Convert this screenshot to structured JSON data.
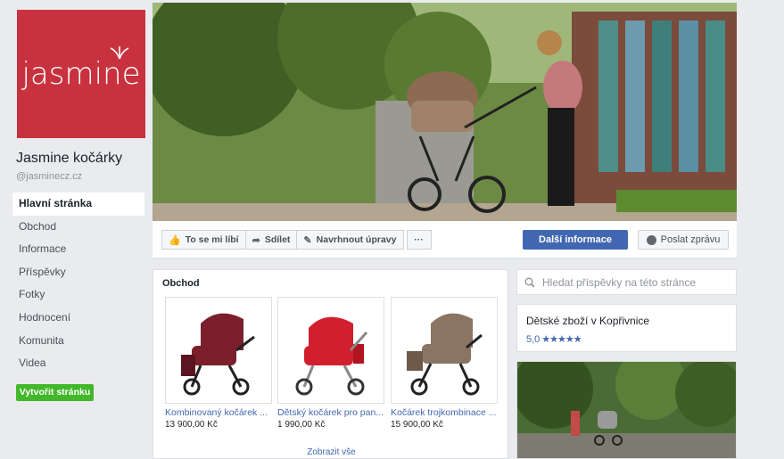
{
  "brand": {
    "logo_text": "jasmine",
    "logo_color": "#c8323e"
  },
  "page": {
    "name": "Jasmine kočárky",
    "handle": "@jasminecz.cz"
  },
  "nav": {
    "items": [
      {
        "label": "Hlavní stránka",
        "active": true
      },
      {
        "label": "Obchod"
      },
      {
        "label": "Informace"
      },
      {
        "label": "Příspěvky"
      },
      {
        "label": "Fotky"
      },
      {
        "label": "Hodnocení"
      },
      {
        "label": "Komunita"
      },
      {
        "label": "Videa"
      }
    ],
    "create_label": "Vytvořit stránku"
  },
  "actions": {
    "like_label": "To se mi líbí",
    "share_label": "Sdílet",
    "suggest_label": "Navrhnout úpravy",
    "more_label": "···",
    "info_label": "Další informace",
    "message_label": "Poslat zprávu"
  },
  "shop": {
    "title": "Obchod",
    "products": [
      {
        "name": "Kombinovaný kočárek ...",
        "price": "13 900,00 Kč",
        "color": "#7a1f2b"
      },
      {
        "name": "Dětský kočárek pro pan...",
        "price": "1 990,00 Kč",
        "color": "#d11f2f"
      },
      {
        "name": "Kočárek trojkombinace ...",
        "price": "15 900,00 Kč",
        "color": "#8b7462"
      }
    ],
    "show_all": "Zobrazit vše"
  },
  "sidebar_right": {
    "search_placeholder": "Hledat příspěvky na této stránce",
    "category": "Dětské zboží v Kopřivnice",
    "rating": "5,0",
    "stars": "★★★★★"
  },
  "colors": {
    "accent": "#4267b2",
    "green": "#42b72a"
  }
}
